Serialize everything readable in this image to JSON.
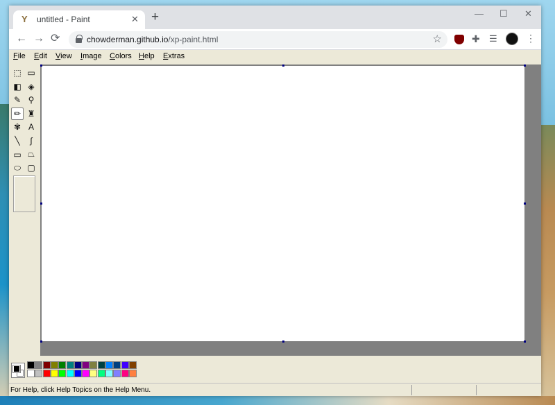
{
  "browser": {
    "tab_title": "untitled - Paint",
    "tab_close": "✕",
    "new_tab": "+",
    "url_host": "chowderman.github.io",
    "url_path": "/xp-paint.html",
    "nav_back": "←",
    "nav_forward": "→",
    "nav_reload": "⟳",
    "window_min": "—",
    "window_max": "☐",
    "window_close": "✕"
  },
  "menubar": {
    "items": [
      {
        "key": "F",
        "rest": "ile"
      },
      {
        "key": "E",
        "rest": "dit"
      },
      {
        "key": "V",
        "rest": "iew"
      },
      {
        "key": "I",
        "rest": "mage"
      },
      {
        "key": "C",
        "rest": "olors"
      },
      {
        "key": "H",
        "rest": "elp"
      },
      {
        "key": "E",
        "rest": "xtras"
      }
    ]
  },
  "tools": [
    {
      "name": "free-select-icon",
      "glyph": "⬚"
    },
    {
      "name": "rect-select-icon",
      "glyph": "▭"
    },
    {
      "name": "eraser-icon",
      "glyph": "◧"
    },
    {
      "name": "fill-bucket-icon",
      "glyph": "◈"
    },
    {
      "name": "color-picker-icon",
      "glyph": "✎"
    },
    {
      "name": "magnifier-icon",
      "glyph": "⚲"
    },
    {
      "name": "pencil-icon",
      "glyph": "✏",
      "selected": true
    },
    {
      "name": "brush-icon",
      "glyph": "♜"
    },
    {
      "name": "airbrush-icon",
      "glyph": "✾"
    },
    {
      "name": "text-icon",
      "glyph": "A"
    },
    {
      "name": "line-icon",
      "glyph": "╲"
    },
    {
      "name": "curve-icon",
      "glyph": "∫"
    },
    {
      "name": "rectangle-icon",
      "glyph": "▭"
    },
    {
      "name": "polygon-icon",
      "glyph": "⏢"
    },
    {
      "name": "ellipse-icon",
      "glyph": "⬭"
    },
    {
      "name": "rounded-rect-icon",
      "glyph": "▢"
    }
  ],
  "colors": {
    "foreground": "#000000",
    "background": "#ffffff",
    "palette_top": [
      "#000000",
      "#808080",
      "#800000",
      "#808000",
      "#008000",
      "#008080",
      "#000080",
      "#800080",
      "#808040",
      "#004040",
      "#0080ff",
      "#004080",
      "#4000ff",
      "#804000"
    ],
    "palette_bottom": [
      "#ffffff",
      "#c0c0c0",
      "#ff0000",
      "#ffff00",
      "#00ff00",
      "#00ffff",
      "#0000ff",
      "#ff00ff",
      "#ffff80",
      "#00ff80",
      "#80ffff",
      "#8080ff",
      "#ff0080",
      "#ff8040"
    ]
  },
  "status": {
    "help_text": "For Help, click Help Topics on the Help Menu."
  }
}
